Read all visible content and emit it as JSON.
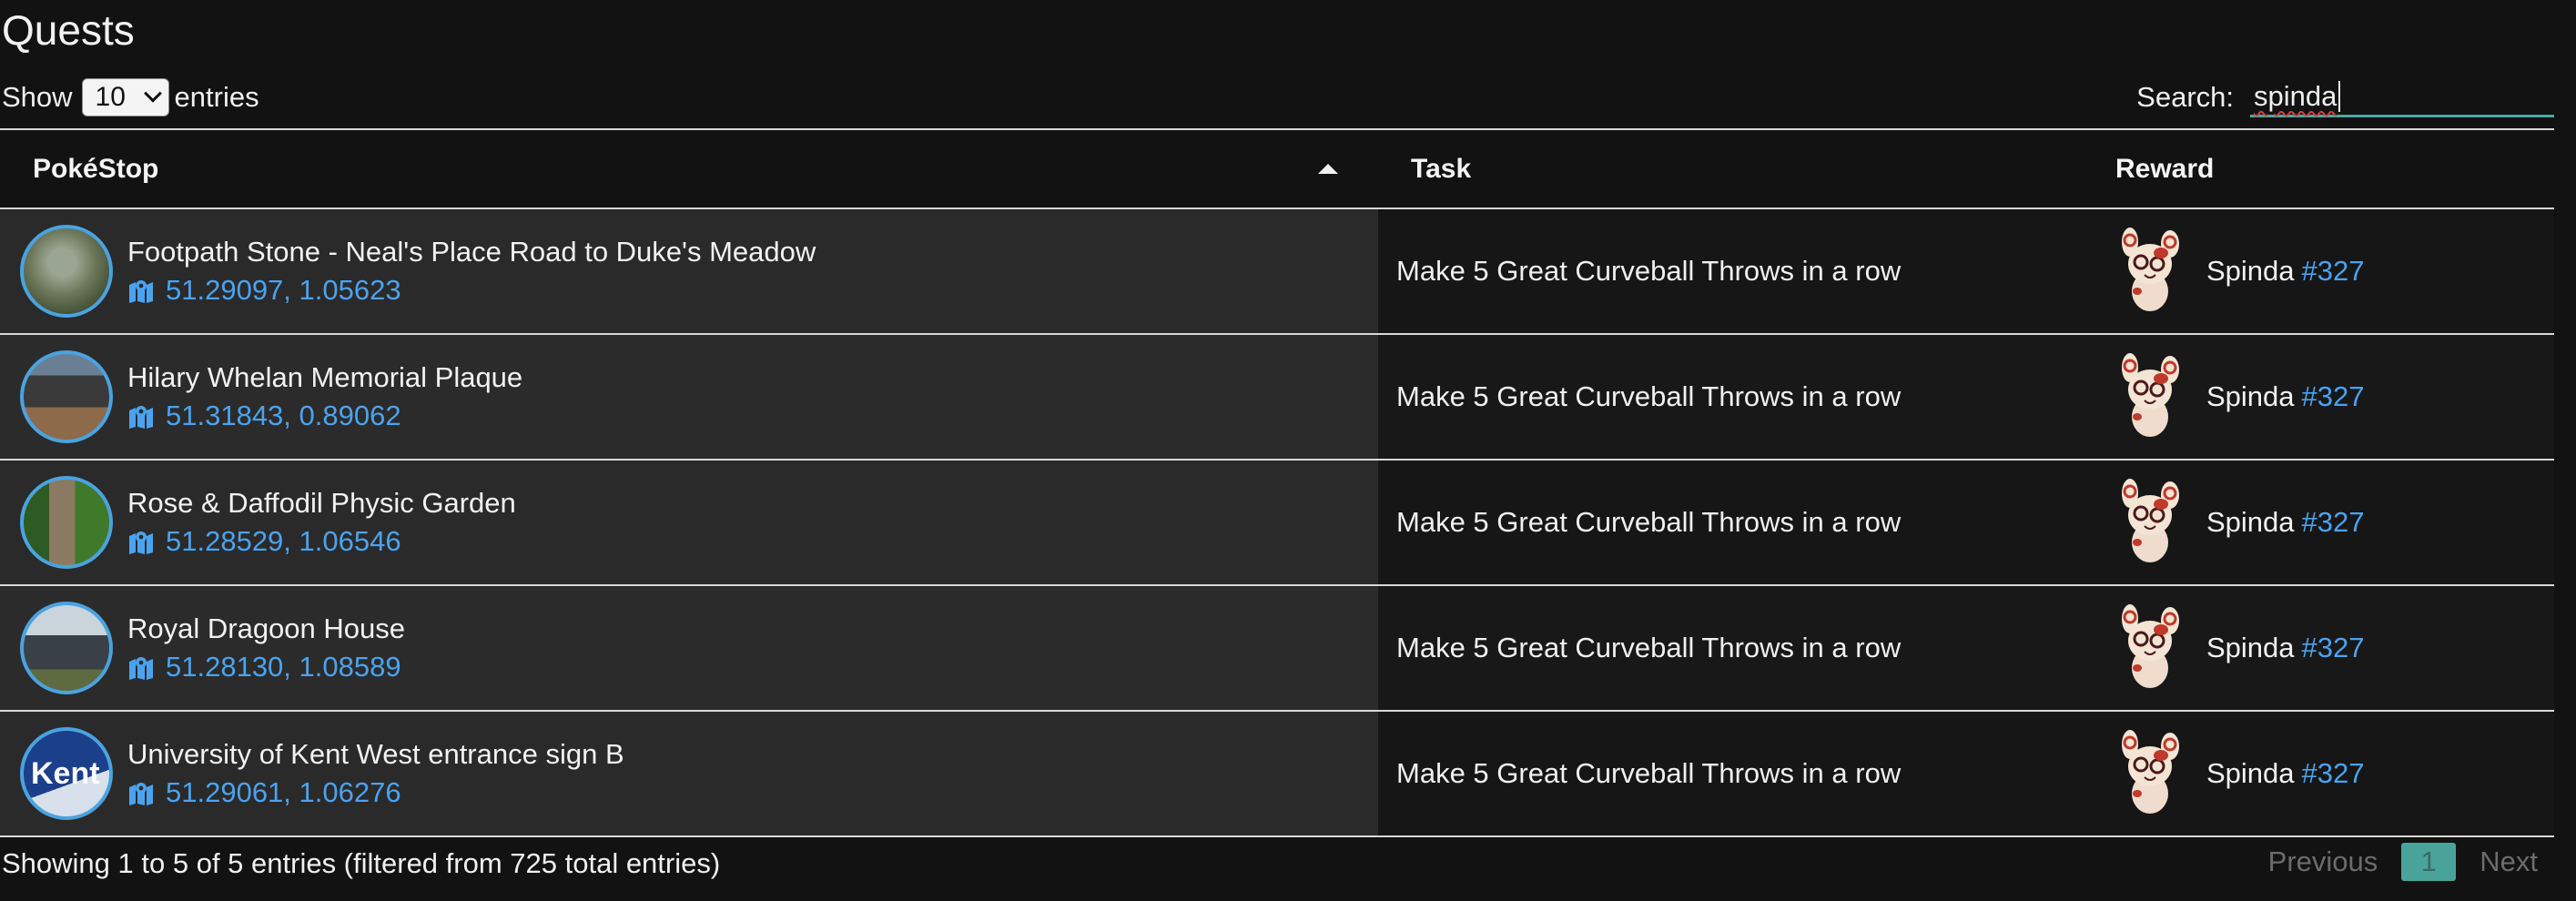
{
  "page": {
    "title": "Quests"
  },
  "length": {
    "label_before": "Show",
    "selected": "10",
    "label_after": "entries"
  },
  "search": {
    "label": "Search:",
    "value": "spinda"
  },
  "table": {
    "headers": {
      "stop": "PokéStop",
      "task": "Task",
      "reward": "Reward"
    },
    "sort_column": "PokéStop",
    "sort_direction": "ascending",
    "rows": [
      {
        "name": "Footpath Stone - Neal's Place Road to Duke's Meadow",
        "coords": "51.29097, 1.05623",
        "task": "Make 5 Great Curveball Throws in a row",
        "reward_name": "Spinda",
        "reward_number": "#327"
      },
      {
        "name": "Hilary Whelan Memorial Plaque",
        "coords": "51.31843, 0.89062",
        "task": "Make 5 Great Curveball Throws in a row",
        "reward_name": "Spinda",
        "reward_number": "#327"
      },
      {
        "name": "Rose & Daffodil Physic Garden",
        "coords": "51.28529, 1.06546",
        "task": "Make 5 Great Curveball Throws in a row",
        "reward_name": "Spinda",
        "reward_number": "#327"
      },
      {
        "name": "Royal Dragoon House",
        "coords": "51.28130, 1.08589",
        "task": "Make 5 Great Curveball Throws in a row",
        "reward_name": "Spinda",
        "reward_number": "#327"
      },
      {
        "name": "University of Kent West entrance sign B",
        "coords": "51.29061, 1.06276",
        "task": "Make 5 Great Curveball Throws in a row",
        "reward_name": "Spinda",
        "reward_number": "#327"
      }
    ]
  },
  "footer": {
    "info": "Showing 1 to 5 of 5 entries (filtered from 725 total entries)",
    "previous": "Previous",
    "current_page": "1",
    "next": "Next"
  },
  "thumb_text": {
    "row4": "Kent"
  },
  "colors": {
    "background": "#121212",
    "link": "#4aa3f0",
    "accent": "#4aa39a",
    "thumb_border": "#4aa3e0"
  }
}
